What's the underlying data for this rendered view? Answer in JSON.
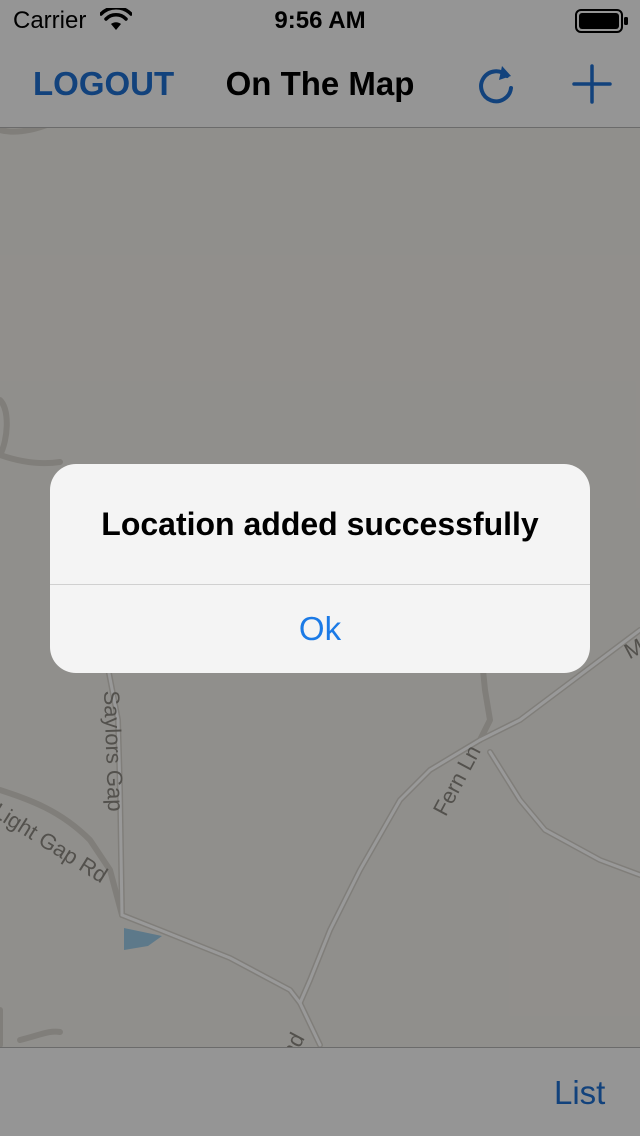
{
  "status_bar": {
    "carrier": "Carrier",
    "time": "9:56 AM",
    "wifi_icon": "wifi-icon",
    "battery_icon": "battery-icon"
  },
  "nav_bar": {
    "logout_label": "LOGOUT",
    "title": "On The Map",
    "refresh_icon": "refresh-icon",
    "add_icon": "plus-icon"
  },
  "map": {
    "road_labels": [
      "Saylors Gap",
      "Light Gap Rd",
      "Fern Ln",
      "Ma",
      "nd"
    ]
  },
  "tab_bar": {
    "list_label": "List"
  },
  "alert": {
    "title": "Location added successfully",
    "ok_label": "Ok"
  },
  "colors": {
    "accent": "#1e6ecf",
    "alert_button": "#1b7ae6",
    "overlay": "rgba(0,0,0,0.40)",
    "map_background": "#f1efe9",
    "water": "#9ccae6"
  }
}
